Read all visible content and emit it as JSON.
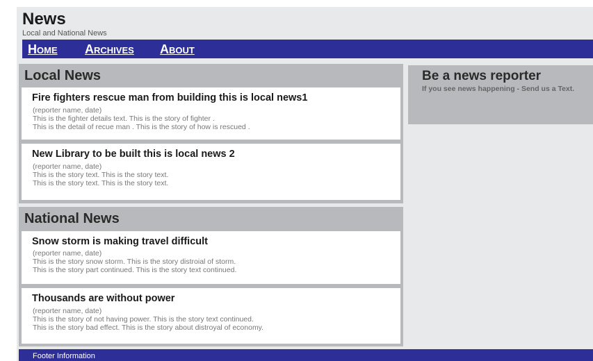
{
  "header": {
    "title": "News",
    "subtitle": "Local and National News"
  },
  "nav": {
    "items": [
      {
        "label": "Home"
      },
      {
        "label": "Archives"
      },
      {
        "label": "About"
      }
    ]
  },
  "sections": [
    {
      "title": "Local News",
      "stories": [
        {
          "title": "Fire fighters rescue man from building this is local news1",
          "meta": "(reporter name, date)",
          "lines": [
            "This is the fighter details text. This is the story of fighter .",
            "This is the detail of recue man . This is the story of how is rescued ."
          ]
        },
        {
          "title": "New Library to be built this is local news 2",
          "meta": "(reporter name, date)",
          "lines": [
            "This is the story text. This is the story text.",
            "This is the story text. This is the story text."
          ]
        }
      ]
    },
    {
      "title": "National News",
      "stories": [
        {
          "title": "Snow storm is making travel difficult",
          "meta": "(reporter name, date)",
          "lines": [
            "This is the story snow storm. This is the story distroial of storm.",
            "This is the story part continued. This is the story text continued."
          ]
        },
        {
          "title": "Thousands are without power",
          "meta": "(reporter name, date)",
          "lines": [
            "This is the story of not having power. This is the story text continued.",
            "This is the story bad effect. This is the story about distroyal of economy."
          ]
        }
      ]
    }
  ],
  "sidebar": {
    "title": "Be a news reporter",
    "text": "If you see news happening - Send us a Text."
  },
  "footer": {
    "text": "Footer Information"
  }
}
